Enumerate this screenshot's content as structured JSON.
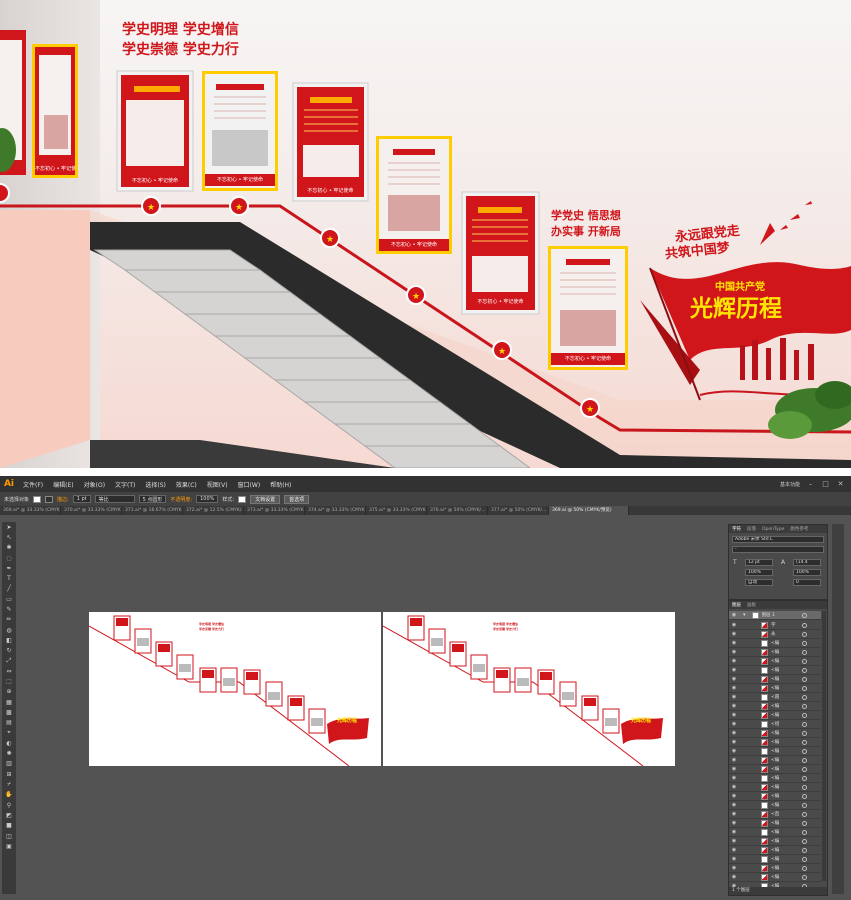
{
  "render": {
    "slogan_left_1": "学史明理  学史增信",
    "slogan_left_2": "学史崇德  学史力行",
    "slogan_mid_1": "学党史 悟思想",
    "slogan_mid_2": "办实事 开新局",
    "slogan_right_1": "永远跟党走",
    "slogan_right_2": "共筑中国梦",
    "flag_sub": "中国共产党",
    "flag_main": "光辉历程",
    "panel_caption": "不忘初心 • 牢记使命"
  },
  "illustrator": {
    "app_logo": "Ai",
    "menus": [
      "文件(F)",
      "编辑(E)",
      "对象(O)",
      "文字(T)",
      "选择(S)",
      "效果(C)",
      "视图(V)",
      "窗口(W)",
      "帮助(H)"
    ],
    "workspace": "基本功能",
    "control_bar": {
      "selection": "未选择对象",
      "stroke_label": "描边:",
      "stroke_value": "1 pt",
      "line_style": "等比",
      "brush": "5 点圆形",
      "opacity_label": "不透明度:",
      "opacity_value": "100%",
      "style_label": "样式:",
      "doc_setup": "文档设置",
      "prefs": "首选项"
    },
    "doc_tabs": [
      "369.ai* @ 33.33% (CMYK...",
      "370.ai* @ 33.33% (CMYK...",
      "371.ai* @ 16.67% (CMYK...",
      "372.ai* @ 12.5% (CMYK/...",
      "373.ai* @ 33.33% (CMYK...",
      "374.ai* @ 33.33% (CMYK...",
      "375.ai* @ 33.33% (CMYK...",
      "376.ai* @ 50% (CMYK/...",
      "377.ai* @ 50% (CMYK/...",
      "369.ai @ 50% (CMYK/预览)"
    ],
    "char_panel": {
      "tabs": [
        "字符",
        "段落",
        "OpenType",
        "颜色参考"
      ],
      "font": "Adobe 宋体 Std L",
      "style": "-",
      "size": "12 pt",
      "leading": "(14.4",
      "hscale": "100%",
      "vscale": "100%",
      "tracking": "自动",
      "kerning": "0"
    },
    "layers_panel": {
      "tabs": [
        "图层",
        "画板"
      ],
      "layer_name": "图层 1",
      "rows": [
        "字",
        "永",
        "<编",
        "<编",
        "<编",
        "<编",
        "<编",
        "<编",
        "<圆",
        "<编",
        "<编",
        "<组",
        "<编",
        "<编",
        "<编",
        "<编",
        "<编",
        "<编",
        "<编",
        "<编",
        "<编",
        "<直",
        "<编",
        "<编",
        "<编",
        "<编",
        "<编",
        "<编",
        "<编",
        "<编"
      ],
      "footer": "1 个图层"
    }
  }
}
